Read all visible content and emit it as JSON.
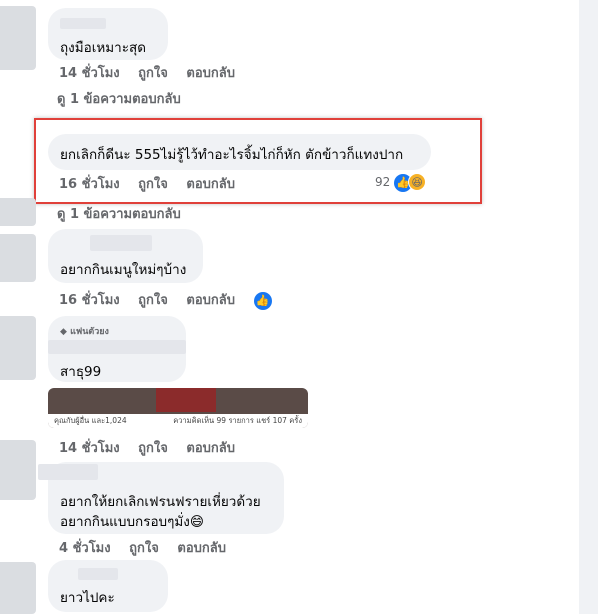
{
  "comments": [
    {
      "text": "ถุงมือเหมาะสุด",
      "time": "14 ชั่วโมง",
      "like": "ถูกใจ",
      "reply": "ตอบกลับ",
      "view_replies": "ดู 1 ข้อความตอบกลับ"
    },
    {
      "text": "ยกเลิกก็ดีนะ 555ไม่รู้ไว้ทำอะไรจิ้มไก่ก็หัก ตักข้าวก็แทงปาก",
      "time": "16 ชั่วโมง",
      "like": "ถูกใจ",
      "reply": "ตอบกลับ",
      "reaction_count": "92",
      "view_replies": "ดู 1 ข้อความตอบกลับ"
    },
    {
      "text": "อยากกินเมนูใหม่ๆบ้าง",
      "time": "16 ชั่วโมง",
      "like": "ถูกใจ",
      "reply": "ตอบกลับ"
    },
    {
      "badge": "แฟนตัวยง",
      "text": "สาธุ99"
    },
    {
      "media_caption_left": "คุณกับผู้อื่น และ1,024",
      "media_caption_right": "ความคิดเห็น 99 รายการ  แชร์ 107 ครั้ง",
      "time": "14 ชั่วโมง",
      "like": "ถูกใจ",
      "reply": "ตอบกลับ"
    },
    {
      "text_line1": "อยากให้ยกเลิกเฟรนฟรายเหี่ยวด้วย",
      "text_line2": "อยากกินแบบกรอบๆมั่ง😄",
      "time": "4 ชั่วโมง",
      "like": "ถูกใจ",
      "reply": "ตอบกลับ"
    },
    {
      "text": "ยาวไปคะ"
    }
  ],
  "icons": {
    "like": "like-icon",
    "haha": "haha-emoji-icon",
    "diamond": "diamond-badge-icon"
  },
  "colors": {
    "highlight": "#e0403a",
    "facebook_blue": "#1877f2"
  }
}
